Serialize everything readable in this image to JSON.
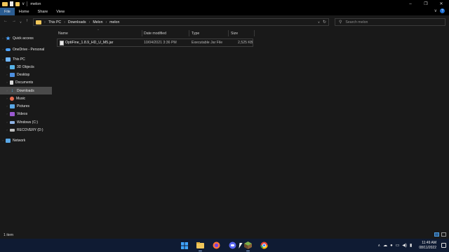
{
  "window": {
    "title": "melon",
    "controls": [
      "minimize",
      "restore",
      "close"
    ]
  },
  "ribbon": {
    "tabs": [
      {
        "label": "File",
        "active": true
      },
      {
        "label": "Home",
        "active": false
      },
      {
        "label": "Share",
        "active": false
      },
      {
        "label": "View",
        "active": false
      }
    ]
  },
  "address": {
    "crumbs": [
      "This PC",
      "Downloads",
      "Melon",
      "melon"
    ]
  },
  "search": {
    "placeholder": "Search melon"
  },
  "sidebar": {
    "items": [
      {
        "label": "Quick access",
        "icon": "star-icon",
        "color": "#4da3ff"
      },
      {
        "label": "OneDrive - Personal",
        "icon": "cloud-icon",
        "color": "#4da3ff"
      },
      {
        "label": "This PC",
        "icon": "computer-icon",
        "color": "#6fb6ff"
      },
      {
        "label": "3D Objects",
        "icon": "cube-icon",
        "color": "#57b3e8"
      },
      {
        "label": "Desktop",
        "icon": "desktop-icon",
        "color": "#4d8fe0"
      },
      {
        "label": "Documents",
        "icon": "document-icon",
        "color": "#d9d9d9"
      },
      {
        "label": "Downloads",
        "icon": "download-icon",
        "color": "#4fb3e8"
      },
      {
        "label": "Music",
        "icon": "music-icon",
        "color": "#e86b4f"
      },
      {
        "label": "Pictures",
        "icon": "picture-icon",
        "color": "#5aa8e6"
      },
      {
        "label": "Videos",
        "icon": "video-icon",
        "color": "#9b59d0"
      },
      {
        "label": "Windows (C:)",
        "icon": "drive-icon",
        "color": "#8fb4e6"
      },
      {
        "label": "RECOVERY (D:)",
        "icon": "drive-icon",
        "color": "#bdbdbd"
      },
      {
        "label": "Network",
        "icon": "network-icon",
        "color": "#5aa8e6"
      }
    ]
  },
  "columns": {
    "name": "Name",
    "date": "Date modified",
    "type": "Type",
    "size": "Size"
  },
  "files": [
    {
      "name": "OptiFine_1.8.9_HD_U_M5.jar",
      "date": "10/04/2021 3:36 PM",
      "type": "Executable Jar File",
      "size": "2,525 KB"
    }
  ],
  "status": {
    "text": "1 item"
  },
  "taskbar": {
    "apps": [
      {
        "name": "windows-start-icon",
        "color": "#3fa4ff"
      },
      {
        "name": "file-explorer-icon",
        "color": "#f0c65a"
      },
      {
        "name": "firefox-icon",
        "color": "#ff7139"
      },
      {
        "name": "discord-icon",
        "color": "#5865f2"
      },
      {
        "name": "minecraft-icon",
        "color": "#7fb04a"
      },
      {
        "name": "chrome-icon",
        "color": "#e94235"
      }
    ],
    "clock_time": "11:49 AM",
    "clock_date": "08/11/2022"
  }
}
